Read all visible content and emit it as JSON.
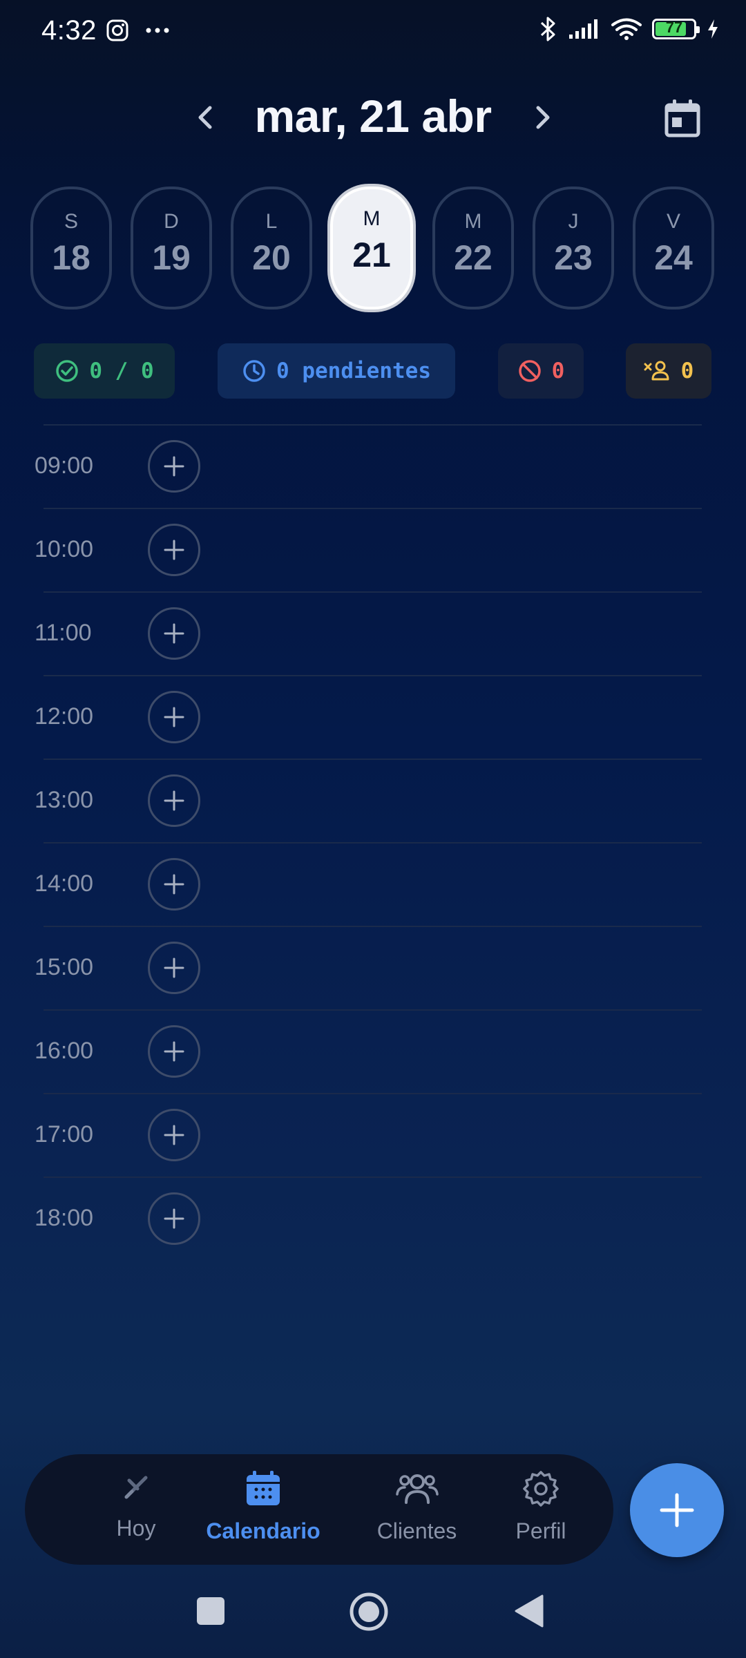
{
  "status_bar": {
    "time": "4:32",
    "battery_level": "77",
    "icons": [
      "instagram-icon",
      "more-icon",
      "bluetooth-icon",
      "signal-icon",
      "wifi-icon",
      "battery-icon",
      "charging-icon"
    ]
  },
  "header": {
    "title": "mar, 21 abr",
    "prev_icon": "chevron-left-icon",
    "next_icon": "chevron-right-icon",
    "calendar_icon": "calendar-icon"
  },
  "days": [
    {
      "letter": "S",
      "number": "18",
      "selected": false
    },
    {
      "letter": "D",
      "number": "19",
      "selected": false
    },
    {
      "letter": "L",
      "number": "20",
      "selected": false
    },
    {
      "letter": "M",
      "number": "21",
      "selected": true
    },
    {
      "letter": "M",
      "number": "22",
      "selected": false
    },
    {
      "letter": "J",
      "number": "23",
      "selected": false
    },
    {
      "letter": "V",
      "number": "24",
      "selected": false
    }
  ],
  "stats": {
    "completed": "0 / 0",
    "pending": "0 pendientes",
    "cancelled": "0",
    "no_show": "0"
  },
  "slots": [
    "09:00",
    "10:00",
    "11:00",
    "12:00",
    "13:00",
    "14:00",
    "15:00",
    "16:00",
    "17:00",
    "18:00"
  ],
  "bottom_nav": {
    "items": [
      {
        "label": "Hoy",
        "icon": "scissors-icon",
        "active": false
      },
      {
        "label": "Calendario",
        "icon": "calendar-icon",
        "active": true
      },
      {
        "label": "Clientes",
        "icon": "users-icon",
        "active": false
      },
      {
        "label": "Perfil",
        "icon": "gear-icon",
        "active": false
      }
    ],
    "fab_icon": "plus-icon"
  },
  "colors": {
    "accent": "#4d8ff0",
    "completed": "#3fbf7f",
    "pending": "#4d8ff0",
    "cancelled": "#f06060",
    "no_show": "#f2c14e"
  }
}
